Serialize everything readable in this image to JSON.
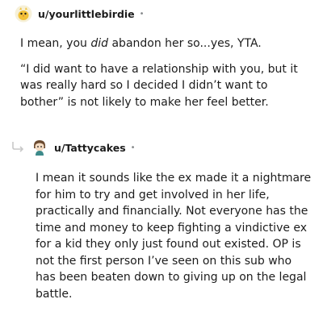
{
  "comment1": {
    "username": "u/yourlittlebirdie",
    "separator": "•",
    "avatar_icon": "bird-avatar-icon",
    "para1_a": "I mean, you ",
    "para1_em": "did",
    "para1_b": " abandon her so...yes, YTA.",
    "para2": "“I did want to have a relationship with you, but it was really hard so I decided I didn’t want to bother” is not likely to make her feel better."
  },
  "comment2": {
    "username": "u/Tattycakes",
    "separator": "•",
    "avatar_icon": "character-avatar-icon",
    "reply_icon": "reply-arrow-icon",
    "body": "I mean it sounds like the ex made it a nightmare for him to try and get involved in her life, practically and financially. Not everyone has the time and money to keep fighting a vindictive ex for a kid they only just found out existed. OP is not the first person I’ve seen on this sub who has been beaten down to giving up on the legal battle."
  }
}
